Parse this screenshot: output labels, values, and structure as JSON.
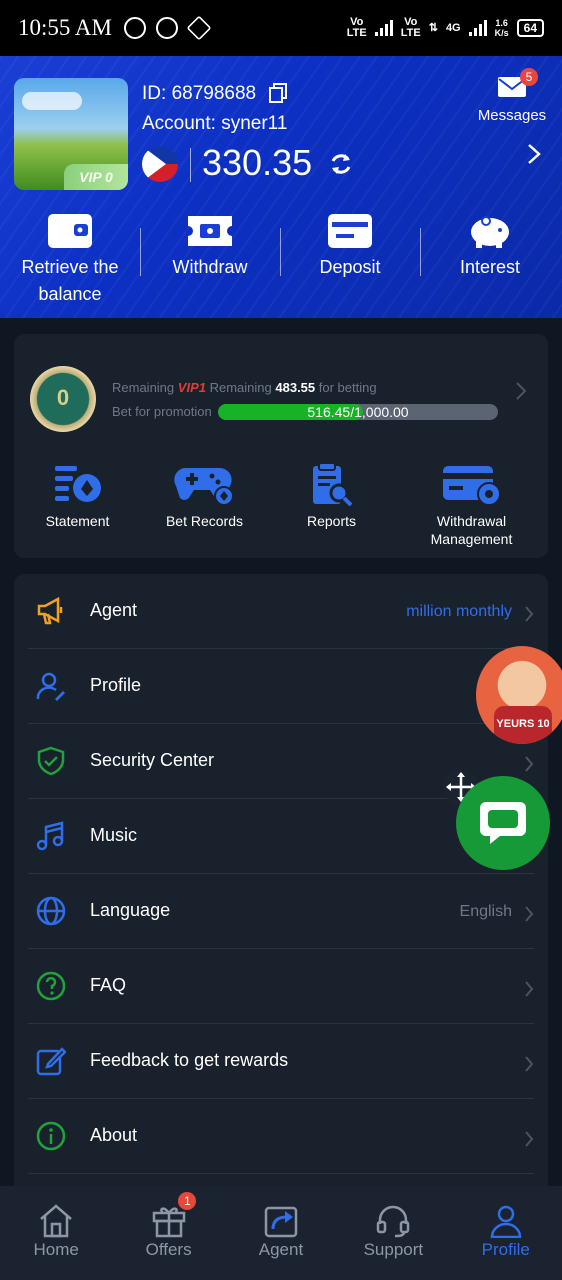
{
  "status_bar": {
    "time": "10:55 AM",
    "net1": "Vo\nLTE",
    "net2": "Vo\nLTE",
    "net4g": "4G",
    "speed": "1.6\nK/s",
    "battery": "64"
  },
  "header": {
    "vip_tag": "VIP 0",
    "id_label": "ID:",
    "id_value": "68798688",
    "account_label": "Account:",
    "account_value": "syner11",
    "balance": "330.35",
    "messages_label": "Messages",
    "messages_badge": "5",
    "actions": [
      {
        "label": "Retrieve the balance",
        "icon": "wallet-icon"
      },
      {
        "label": "Withdraw",
        "icon": "ticket-icon"
      },
      {
        "label": "Deposit",
        "icon": "wallet-open-icon"
      },
      {
        "label": "Interest",
        "icon": "piggy-bank-icon"
      }
    ]
  },
  "vip_card": {
    "medal_level": "0",
    "remaining_prefix": "Remaining",
    "vip_name": "VIP1",
    "remaining_mid": "Remaining",
    "remaining_amount": "483.55",
    "remaining_suffix": "for betting",
    "promo_label": "Bet for promotion",
    "progress_text": "516.45/1,000.00",
    "progress_fraction": 0.51645,
    "tools": [
      {
        "label": "Statement",
        "icon": "statement-icon"
      },
      {
        "label": "Bet Records",
        "icon": "gamepad-icon"
      },
      {
        "label": "Reports",
        "icon": "report-icon"
      },
      {
        "label": "Withdrawal Management",
        "icon": "card-settings-icon"
      }
    ]
  },
  "menu": [
    {
      "label": "Agent",
      "value": "million monthly",
      "icon": "megaphone-icon"
    },
    {
      "label": "Profile",
      "value": "",
      "icon": "user-edit-icon"
    },
    {
      "label": "Security Center",
      "value": "",
      "icon": "shield-check-icon"
    },
    {
      "label": "Music",
      "value": "",
      "icon": "music-icon"
    },
    {
      "label": "Language",
      "value": "English",
      "icon": "globe-icon"
    },
    {
      "label": "FAQ",
      "value": "",
      "icon": "question-icon"
    },
    {
      "label": "Feedback to get rewards",
      "value": "",
      "icon": "edit-icon"
    },
    {
      "label": "About",
      "value": "",
      "icon": "info-icon"
    }
  ],
  "floating": {
    "avatar_jersey": "YEURS 10"
  },
  "bottom_nav": [
    {
      "label": "Home",
      "icon": "home-icon"
    },
    {
      "label": "Offers",
      "icon": "gift-icon",
      "badge": "1"
    },
    {
      "label": "Agent",
      "icon": "share-icon"
    },
    {
      "label": "Support",
      "icon": "headset-icon"
    },
    {
      "label": "Profile",
      "icon": "user-icon",
      "active": true
    }
  ],
  "colors": {
    "header_blue": "#0d30c4",
    "accent_blue": "#2f6ee8",
    "progress_green": "#17b226",
    "vip_red": "#e53b35",
    "chat_green": "#169a38"
  }
}
